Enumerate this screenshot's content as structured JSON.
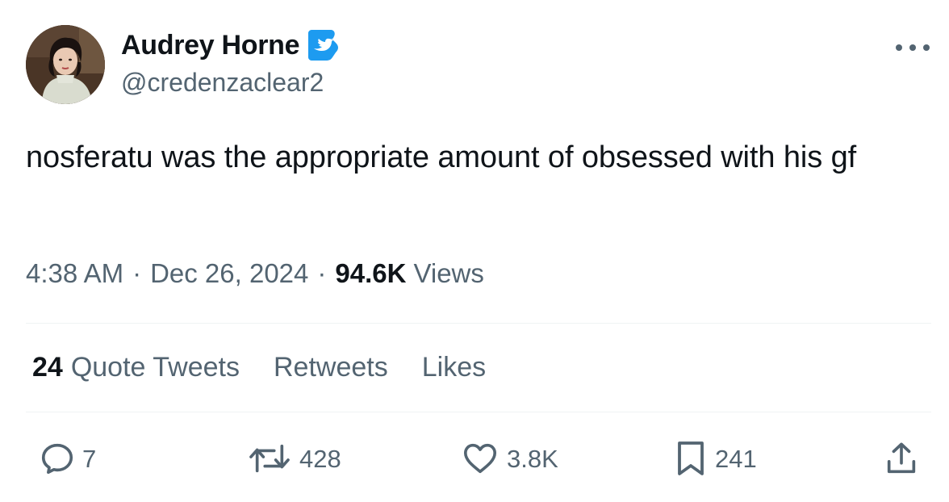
{
  "author": {
    "display_name": "Audrey Horne",
    "handle": "@credenzaclear2",
    "verified_icon": "twitter-bird-badge",
    "badge_color": "#1d9bf0"
  },
  "tweet": {
    "text": "nosferatu was the appropriate amount of obsessed with his gf",
    "time": "4:38 AM",
    "separator": "·",
    "date": "Dec 26, 2024",
    "views_count": "94.6K",
    "views_label": "Views"
  },
  "stats": {
    "quote_tweets_count": "24",
    "quote_tweets_label": "Quote Tweets",
    "retweets_label": "Retweets",
    "likes_label": "Likes"
  },
  "actions": {
    "reply_count": "7",
    "retweet_count": "428",
    "like_count": "3.8K",
    "bookmark_count": "241"
  },
  "icons": [
    "more-icon",
    "reply-icon",
    "retweet-icon",
    "heart-icon",
    "bookmark-icon",
    "share-icon"
  ],
  "colors": {
    "text_primary": "#0f1419",
    "text_secondary": "#536471",
    "divider": "#eff3f4"
  }
}
